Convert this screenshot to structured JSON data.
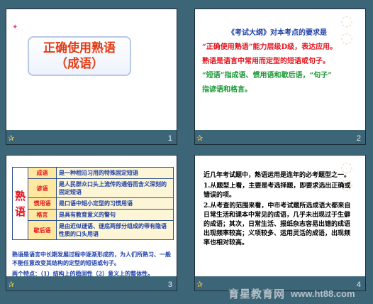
{
  "slides": [
    {
      "number": "1",
      "title_line1": "正确使用熟语",
      "title_line2": "（成语）"
    },
    {
      "number": "2",
      "lines": [
        "《考试大纲》对本考点的要求是",
        "“正确使用熟语”能力层级D级，表达应用。",
        "熟语是语言中常用而定型的短语或句子。",
        "“短语”指成语、惯用语和歇后语，“句子”",
        "指谚语和格言。"
      ]
    },
    {
      "number": "3",
      "big_label": "熟语",
      "rows": [
        {
          "name": "成语",
          "def": "是一种相沿习用的特殊固定短语"
        },
        {
          "name": "谚语",
          "def": "是人民群众口头上流传的通俗而含义深刻的固定短语"
        },
        {
          "name": "惯用语",
          "def": "是口语中短小定型的习惯用语"
        },
        {
          "name": "格言",
          "def": "是具有教育意义的警句"
        },
        {
          "name": "歇后语",
          "def": "是由近似谜语、谜底两部分组成的带有隐语性质的口头用语"
        }
      ],
      "note": "熟语是语言中长期发展过程中逐渐形成的，为人们所熟习、一般不能任意改变其结构的定型的短语或句子。",
      "features": "两个特点：（1）结构上的稳固性（2）意义上的整体性。"
    },
    {
      "number": "4",
      "para1": "近几年考试题中，熟语运用是连年的必考题型之一。",
      "para2": "1.从题型上看，主要是考选择题，即要求选出正确或错误的项。",
      "para3": "2.从考查的范围来看，中市考试题所选成语大都来自日常生活和课本中常见的成语，几乎未出现过于生僻的成语；其次，日常生活、报纸杂志容易出错的成语出现频率较高；义项较多、运用灵活的成语，出现频率也相对较高。"
    }
  ],
  "banner": {
    "name": "育星教育网",
    "url": "www.ht88.com"
  }
}
